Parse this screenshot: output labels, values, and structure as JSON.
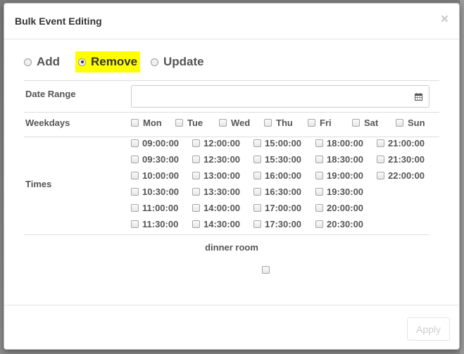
{
  "modal": {
    "title": "Bulk Event Editing",
    "close_label": "×"
  },
  "modes": [
    {
      "label": "Add",
      "checked": false
    },
    {
      "label": "Remove",
      "checked": true,
      "highlight": "#ffff00"
    },
    {
      "label": "Update",
      "checked": false
    }
  ],
  "date_range": {
    "label": "Date Range",
    "value": "",
    "icon": "calendar-icon"
  },
  "weekdays": {
    "label": "Weekdays",
    "days": [
      "Mon",
      "Tue",
      "Wed",
      "Thu",
      "Fri",
      "Sat",
      "Sun"
    ]
  },
  "times": {
    "label": "Times",
    "columns": [
      [
        "09:00:00",
        "09:30:00",
        "10:00:00",
        "10:30:00",
        "11:00:00",
        "11:30:00"
      ],
      [
        "12:00:00",
        "12:30:00",
        "13:00:00",
        "13:30:00",
        "14:00:00",
        "14:30:00"
      ],
      [
        "15:00:00",
        "15:30:00",
        "16:00:00",
        "16:30:00",
        "17:00:00",
        "17:30:00"
      ],
      [
        "18:00:00",
        "18:30:00",
        "19:00:00",
        "19:30:00",
        "20:00:00",
        "20:30:00"
      ],
      [
        "21:00:00",
        "21:30:00",
        "22:00:00"
      ]
    ]
  },
  "resource": {
    "label": "dinner room",
    "checked": false
  },
  "footer": {
    "apply_label": "Apply"
  }
}
